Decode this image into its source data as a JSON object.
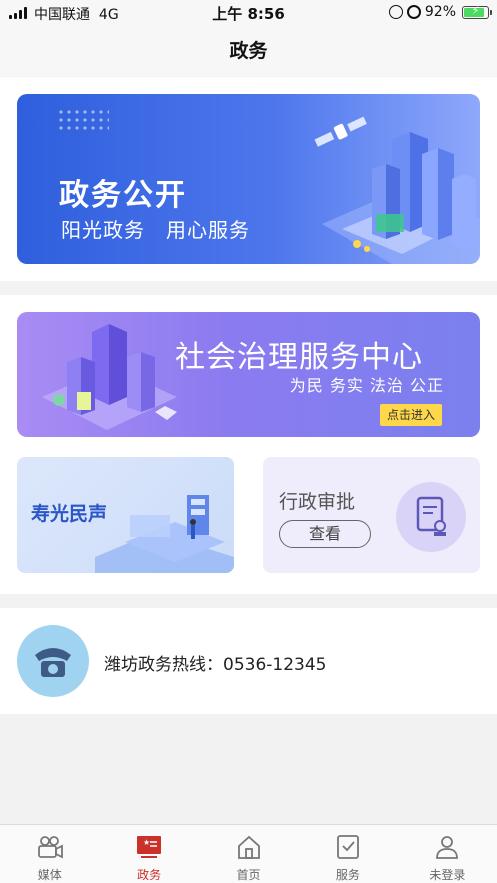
{
  "status_bar": {
    "carrier": "中国联通",
    "network": "4G",
    "time": "上午 8:56",
    "battery": "92%",
    "battery_level": 0.92
  },
  "nav": {
    "title": "政务"
  },
  "gov_banner": {
    "title": "政务公开",
    "subtitle": "阳光政务　用心服务"
  },
  "social_banner": {
    "title": "社会治理服务中心",
    "subtitle": "为民 务实 法治 公正",
    "button": "点击进入"
  },
  "voice_card": {
    "title": "寿光民声"
  },
  "admin_card": {
    "title": "行政审批",
    "button": "查看"
  },
  "hotline": {
    "text": "潍坊政务热线：0536-12345"
  },
  "tabs": [
    {
      "label": "媒体",
      "icon": "camera-icon",
      "active": false
    },
    {
      "label": "政务",
      "icon": "government-icon",
      "active": true
    },
    {
      "label": "首页",
      "icon": "home-icon",
      "active": false
    },
    {
      "label": "服务",
      "icon": "service-icon",
      "active": false
    },
    {
      "label": "未登录",
      "icon": "user-icon",
      "active": false
    }
  ],
  "colors": {
    "accent": "#c9312a",
    "banner_blue": "#2f5fdd",
    "banner_purple": "#8b7bf0",
    "enter_yellow": "#ffd84a"
  }
}
